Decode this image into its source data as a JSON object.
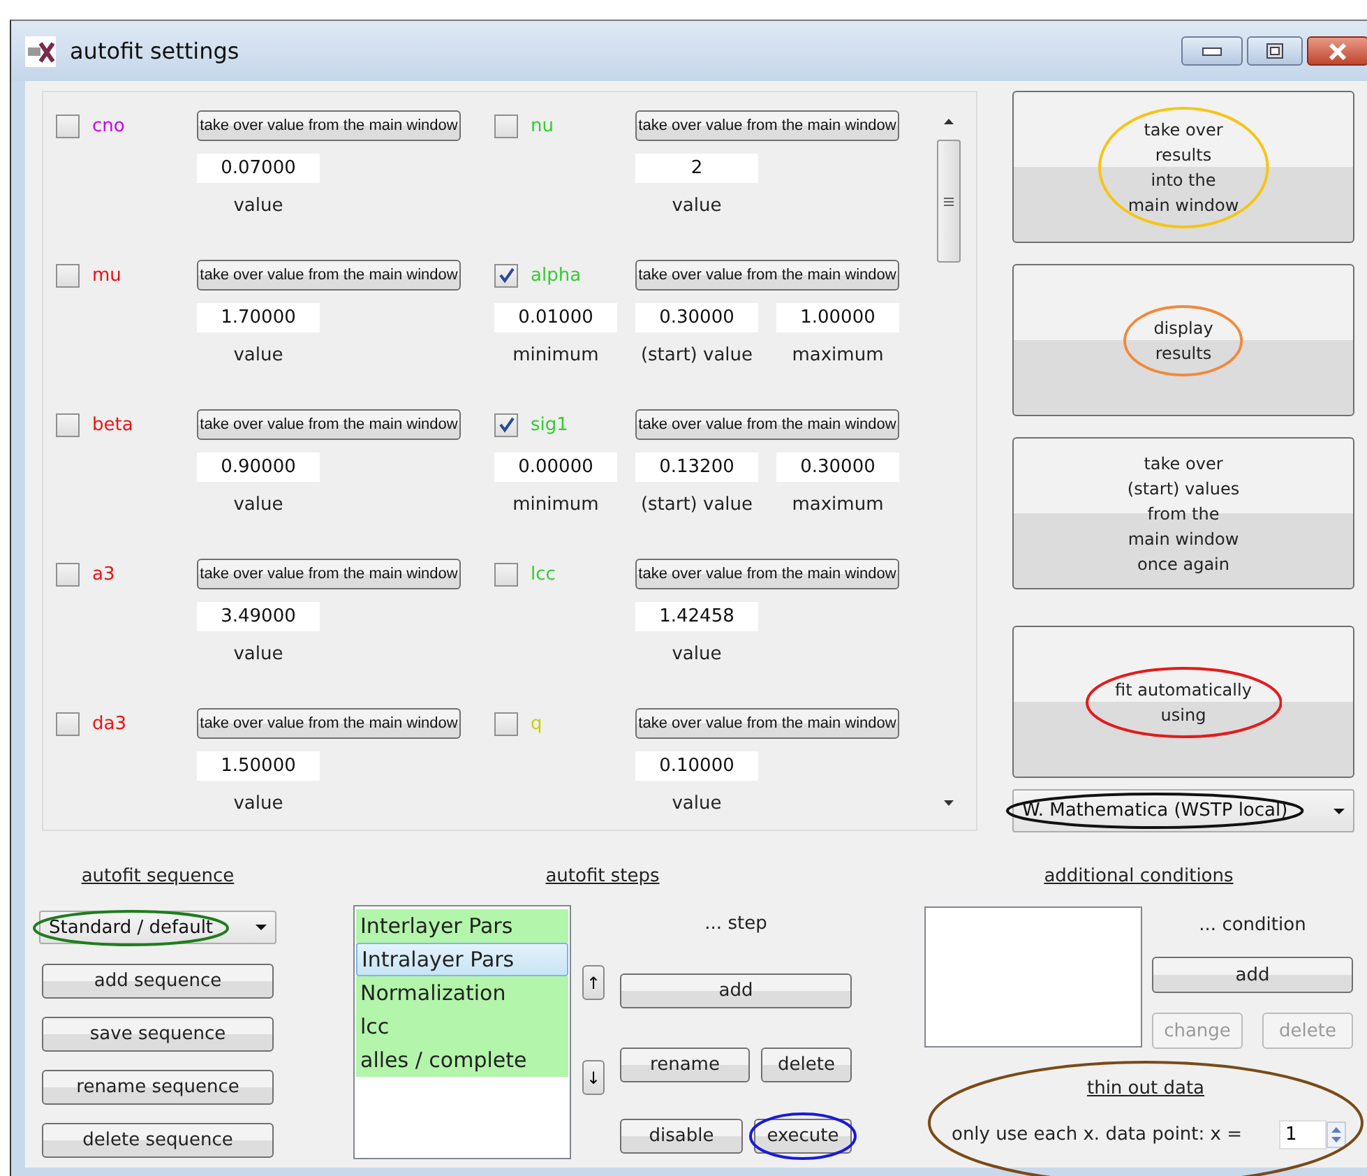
{
  "window": {
    "title": "autofit settings"
  },
  "parameters": [
    {
      "name": "cno",
      "color": "#cc00ee",
      "checked": false,
      "button": "take over value from the main window",
      "kind": "single",
      "fields": [
        {
          "value": "0.07000",
          "label": "value"
        }
      ]
    },
    {
      "name": "nu",
      "color": "#33cc33",
      "checked": false,
      "button": "take over value from the main window",
      "kind": "single",
      "fields": [
        {
          "value": "2",
          "label": "value"
        }
      ]
    },
    {
      "name": "mu",
      "color": "#ee1111",
      "checked": false,
      "button": "take over value from the main window",
      "kind": "single",
      "fields": [
        {
          "value": "1.70000",
          "label": "value"
        }
      ]
    },
    {
      "name": "alpha",
      "color": "#33cc33",
      "checked": true,
      "button": "take over value from the main window",
      "kind": "range",
      "fields": [
        {
          "value": "0.01000",
          "label": "minimum"
        },
        {
          "value": "0.30000",
          "label": "(start) value"
        },
        {
          "value": "1.00000",
          "label": "maximum"
        }
      ]
    },
    {
      "name": "beta",
      "color": "#ee1111",
      "checked": false,
      "button": "take over value from the main window",
      "kind": "single",
      "fields": [
        {
          "value": "0.90000",
          "label": "value"
        }
      ]
    },
    {
      "name": "sig1",
      "color": "#33cc33",
      "checked": true,
      "button": "take over value from the main window",
      "kind": "range",
      "fields": [
        {
          "value": "0.00000",
          "label": "minimum"
        },
        {
          "value": "0.13200",
          "label": "(start) value"
        },
        {
          "value": "0.30000",
          "label": "maximum"
        }
      ]
    },
    {
      "name": "a3",
      "color": "#ee1111",
      "checked": false,
      "button": "take over value from the main window",
      "kind": "single",
      "fields": [
        {
          "value": "3.49000",
          "label": "value"
        }
      ]
    },
    {
      "name": "lcc",
      "color": "#33cc33",
      "checked": false,
      "button": "take over value from the main window",
      "kind": "single",
      "fields": [
        {
          "value": "1.42458",
          "label": "value"
        }
      ]
    },
    {
      "name": "da3",
      "color": "#ee1111",
      "checked": false,
      "button": "take over value from the main window",
      "kind": "single",
      "fields": [
        {
          "value": "1.50000",
          "label": "value"
        }
      ]
    },
    {
      "name": "q",
      "color": "#cccc00",
      "checked": false,
      "button": "take over value from the main window",
      "kind": "single",
      "fields": [
        {
          "value": "0.10000",
          "label": "value"
        }
      ]
    }
  ],
  "side_buttons": [
    {
      "label": "take over\nresults\ninto the\nmain window",
      "color": "#f5c518"
    },
    {
      "label": "display\nresults",
      "color": "#f08a3c"
    },
    {
      "label": "take over\n(start) values\nfrom the\nmain window\nonce again"
    },
    {
      "label": "fit automatically\nusing",
      "color": "#e31b1b"
    }
  ],
  "method_dropdown": {
    "value": "W. Mathematica (WSTP local)",
    "color": "#111111"
  },
  "sequence": {
    "heading": "autofit sequence",
    "dropdown": {
      "value": "Standard / default",
      "color": "#1e7d1e"
    },
    "buttons": [
      "add sequence",
      "save sequence",
      "rename sequence",
      "delete sequence"
    ]
  },
  "steps": {
    "heading": "autofit steps",
    "items": [
      {
        "label": "Interlayer Pars",
        "selected": false
      },
      {
        "label": "Intralayer Pars",
        "selected": true
      },
      {
        "label": "Normalization",
        "selected": false
      },
      {
        "label": "lcc",
        "selected": false
      },
      {
        "label": "alles / complete",
        "selected": false
      }
    ],
    "move_up": "↑",
    "move_down": "↓",
    "caption": "... step",
    "buttons": [
      {
        "label": "add"
      },
      {
        "label": "rename"
      },
      {
        "label": "delete"
      },
      {
        "label": "disable"
      },
      {
        "label": "execute",
        "color": "#1a1ad6"
      }
    ]
  },
  "conditions": {
    "heading": "additional conditions",
    "caption": "... condition",
    "buttons": [
      {
        "label": "add",
        "disabled": false
      },
      {
        "label": "change",
        "disabled": true
      },
      {
        "label": "delete",
        "disabled": true
      }
    ]
  },
  "thin_out": {
    "heading": "thin out data",
    "label": "only use each x. data point: x =",
    "value": "1",
    "color": "#7a4a16"
  }
}
